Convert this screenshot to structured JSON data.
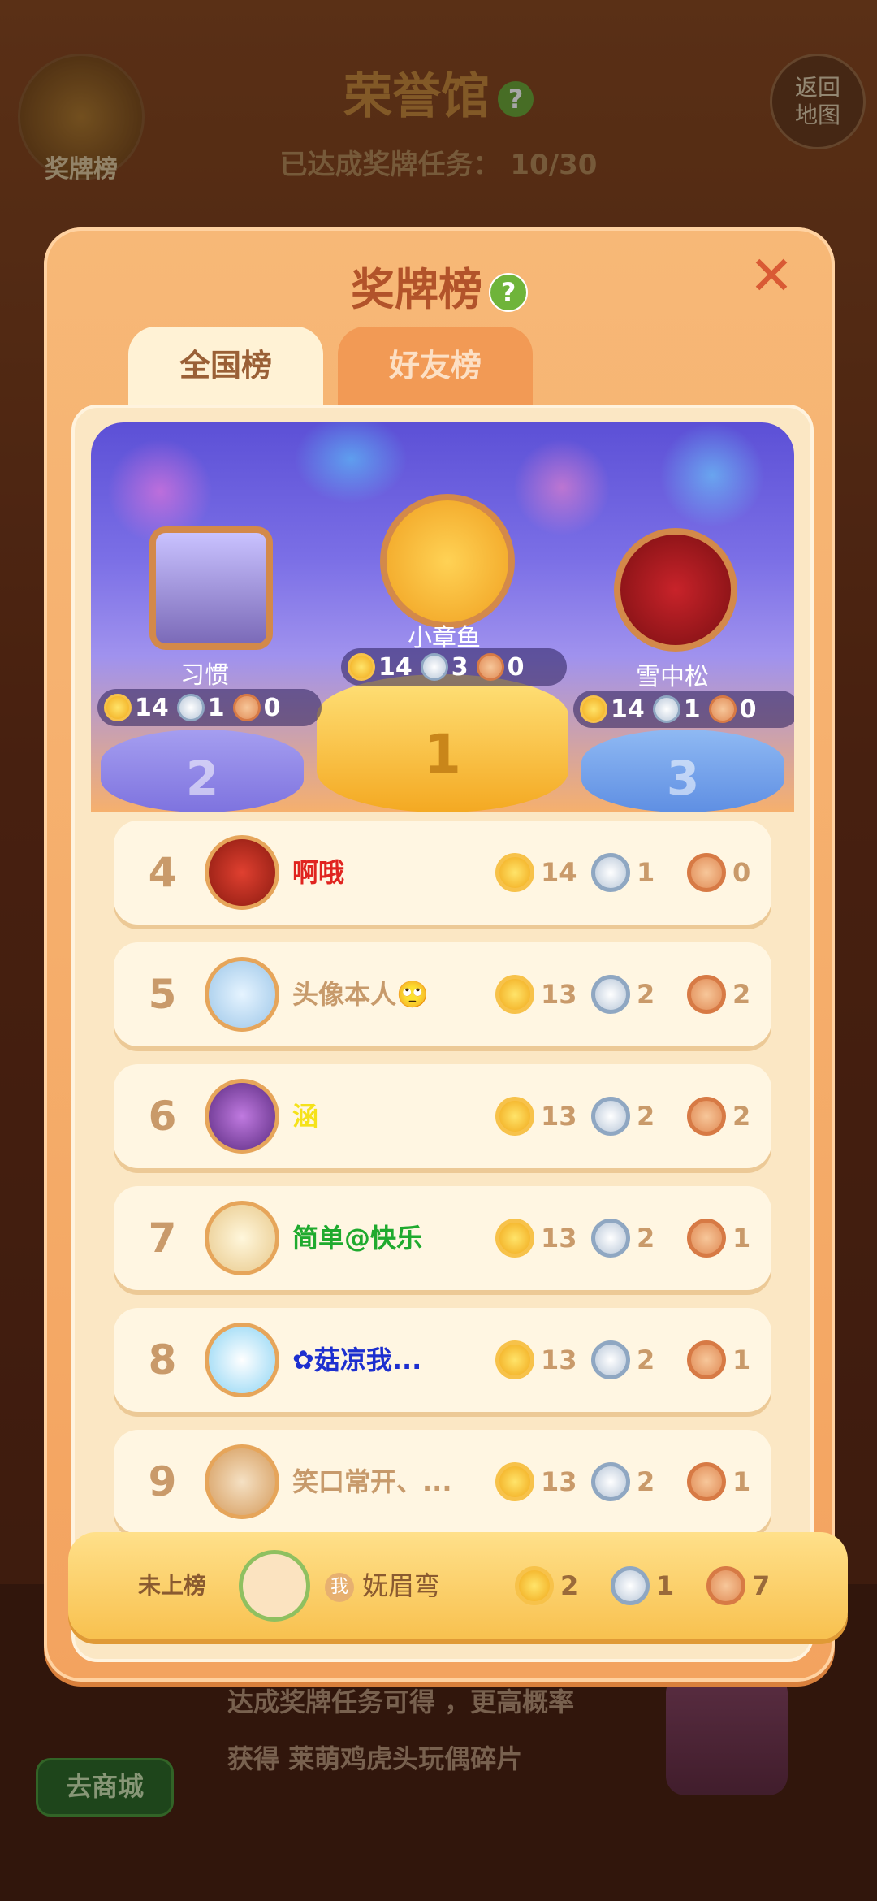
{
  "background": {
    "title": "荣誉馆",
    "task_label": "已达成奖牌任务： 10/30",
    "medal_button_label": "奖牌榜",
    "back_button_label": "返回\n地图",
    "shop_button_label": "去商城",
    "promo_line1": "达成奖牌任务可得      ，更高概率",
    "promo_line2": "获得 莱萌鸡虎头玩偶碎片"
  },
  "modal": {
    "title": "奖牌榜",
    "help_icon": "?",
    "close_icon": "✕",
    "tabs": [
      {
        "label": "全国榜",
        "active": true
      },
      {
        "label": "好友榜",
        "active": false
      }
    ]
  },
  "podium": [
    {
      "rank": "2",
      "name": "习惯",
      "gold": "14",
      "silver": "1",
      "bronze": "0"
    },
    {
      "rank": "1",
      "name": "小章鱼",
      "gold": "14",
      "silver": "3",
      "bronze": "0"
    },
    {
      "rank": "3",
      "name": "雪中松",
      "gold": "14",
      "silver": "1",
      "bronze": "0"
    }
  ],
  "rows": [
    {
      "rank": "4",
      "name": "啊哦",
      "name_color": "#e0241f",
      "gold": "14",
      "silver": "1",
      "bronze": "0"
    },
    {
      "rank": "5",
      "name": "头像本人🙄",
      "name_color": "#c79a6b",
      "gold": "13",
      "silver": "2",
      "bronze": "2"
    },
    {
      "rank": "6",
      "name": "涵",
      "name_color": "#f5e21a",
      "gold": "13",
      "silver": "2",
      "bronze": "2"
    },
    {
      "rank": "7",
      "name": "简单@快乐",
      "name_color": "#1faa2e",
      "gold": "13",
      "silver": "2",
      "bronze": "1"
    },
    {
      "rank": "8",
      "name": "✿菇凉我...",
      "name_color": "#1d2fcf",
      "gold": "13",
      "silver": "2",
      "bronze": "1"
    },
    {
      "rank": "9",
      "name": "笑口常开、...",
      "name_color": "#c79a6b",
      "gold": "13",
      "silver": "2",
      "bronze": "1"
    }
  ],
  "self": {
    "rank_label": "未上榜",
    "me_badge": "我",
    "name": "妩眉弯",
    "gold": "2",
    "silver": "1",
    "bronze": "7"
  },
  "colors": {
    "modal": "#f5a965",
    "panel": "#fbe7c4",
    "podium_top": "#5c50d6",
    "gold": "#f1a81a",
    "silver": "#b7c6d8",
    "bronze": "#e08a55"
  }
}
